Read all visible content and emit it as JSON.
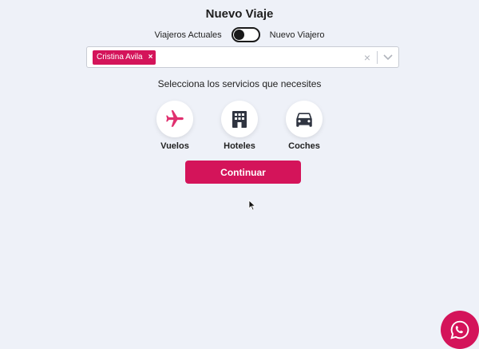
{
  "page": {
    "title": "Nuevo Viaje"
  },
  "toggle": {
    "left_label": "Viajeros Actuales",
    "right_label": "Nuevo Viajero"
  },
  "travelers": {
    "selected": [
      {
        "name": "Cristina Avila",
        "remove": "×"
      }
    ],
    "clear": "×"
  },
  "services": {
    "prompt": "Selecciona los servicios que necesites",
    "items": [
      {
        "label": "Vuelos",
        "icon": "airplane-icon",
        "color": "#e0306f"
      },
      {
        "label": "Hoteles",
        "icon": "hotel-building-icon",
        "color": "#2f3440"
      },
      {
        "label": "Coches",
        "icon": "car-icon",
        "color": "#2f3440"
      }
    ]
  },
  "actions": {
    "continue": "Continuar"
  },
  "colors": {
    "accent": "#d4145a",
    "background": "#eef1f8"
  }
}
